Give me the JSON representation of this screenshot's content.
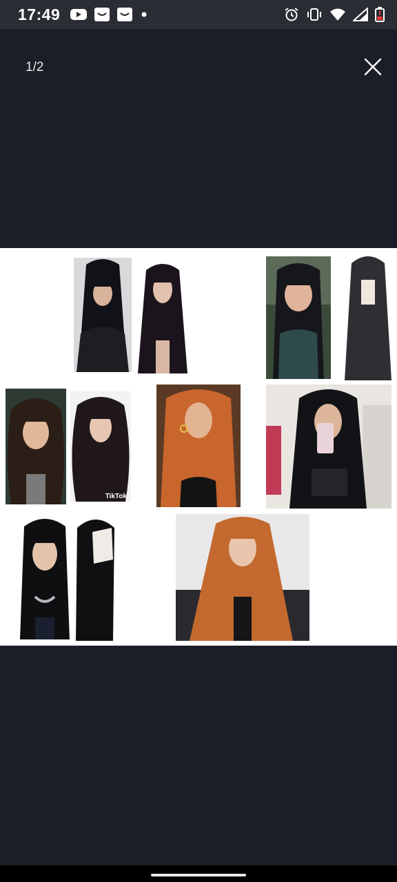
{
  "status_bar": {
    "time": "17:49",
    "left_icons": [
      "youtube-icon",
      "smile-box-icon",
      "smile-box-icon",
      "notification-dot-icon"
    ],
    "right_icons": [
      "alarm-icon",
      "vibrate-icon",
      "wifi-icon",
      "signal-icon",
      "battery-low-icon"
    ]
  },
  "viewer": {
    "page_counter": "1/2",
    "close_icon": "close-icon"
  },
  "collage": {
    "background": "#ffffff",
    "watermark": "TikTok",
    "photos": [
      {
        "name": "black-bangs-wig-photo",
        "hair": "#111217"
      },
      {
        "name": "dark-straight-wig-mannequin-photo",
        "hair": "#1c141c"
      },
      {
        "name": "woman-black-bangs-photo",
        "hair": "#15171b"
      },
      {
        "name": "dark-gray-wig-mannequin-photo",
        "hair": "#2d2f33"
      },
      {
        "name": "woman-wavy-brown-hair-photo",
        "hair": "#2b1e17"
      },
      {
        "name": "wavy-dark-wig-mannequin-photo",
        "hair": "#1f1719"
      },
      {
        "name": "ginger-straight-hair-photo",
        "hair": "#c8662e"
      },
      {
        "name": "mirror-selfie-black-hair-photo",
        "hair": "#121316"
      },
      {
        "name": "woman-black-bangs-necklace-photo",
        "hair": "#0f0f12"
      },
      {
        "name": "black-wig-mannequin-side-photo",
        "hair": "#101013"
      },
      {
        "name": "ginger-wig-mannequin-photo",
        "hair": "#c3692f"
      }
    ]
  },
  "colors": {
    "background": "#1b1e26",
    "status_bar": "#2a2d33",
    "nav_bar": "#000000",
    "home_indicator": "#e6e6e6"
  }
}
